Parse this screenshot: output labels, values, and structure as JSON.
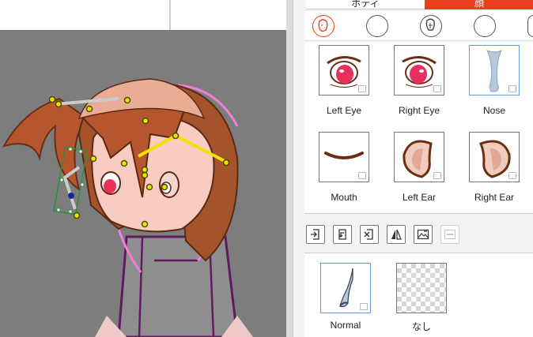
{
  "tabs": [
    {
      "label": "ボディ",
      "active": false
    },
    {
      "label": "顔",
      "active": true
    }
  ],
  "colors": {
    "accent": "#e8401c",
    "selection": "#6a9ad8",
    "canvas_bg": "#7d7d7d",
    "hair": "#b5562e",
    "handle": "#f2e200"
  },
  "categories": [
    {
      "icon": "face-outline-icon",
      "active": true
    },
    {
      "icon": "circle-icon",
      "active": false
    },
    {
      "icon": "head-profile-icon",
      "active": false
    },
    {
      "icon": "circle-icon",
      "active": false
    }
  ],
  "parts": [
    {
      "label": "Left Eye",
      "selected": false
    },
    {
      "label": "Right Eye",
      "selected": false
    },
    {
      "label": "Nose",
      "selected": true
    },
    {
      "label": "Mouth",
      "selected": false
    },
    {
      "label": "Left Ear",
      "selected": false
    },
    {
      "label": "Right Ear",
      "selected": false
    }
  ],
  "toolbar": [
    {
      "icon": "import-icon",
      "enabled": true
    },
    {
      "icon": "replace-icon",
      "enabled": true
    },
    {
      "icon": "delete-icon",
      "enabled": true
    },
    {
      "icon": "flip-icon",
      "enabled": true
    },
    {
      "icon": "export-image-icon",
      "enabled": true
    },
    {
      "icon": "svg-export-icon",
      "enabled": false
    }
  ],
  "variants": [
    {
      "label": "Normal",
      "selected": true
    },
    {
      "label": "なし",
      "selected": false
    }
  ]
}
